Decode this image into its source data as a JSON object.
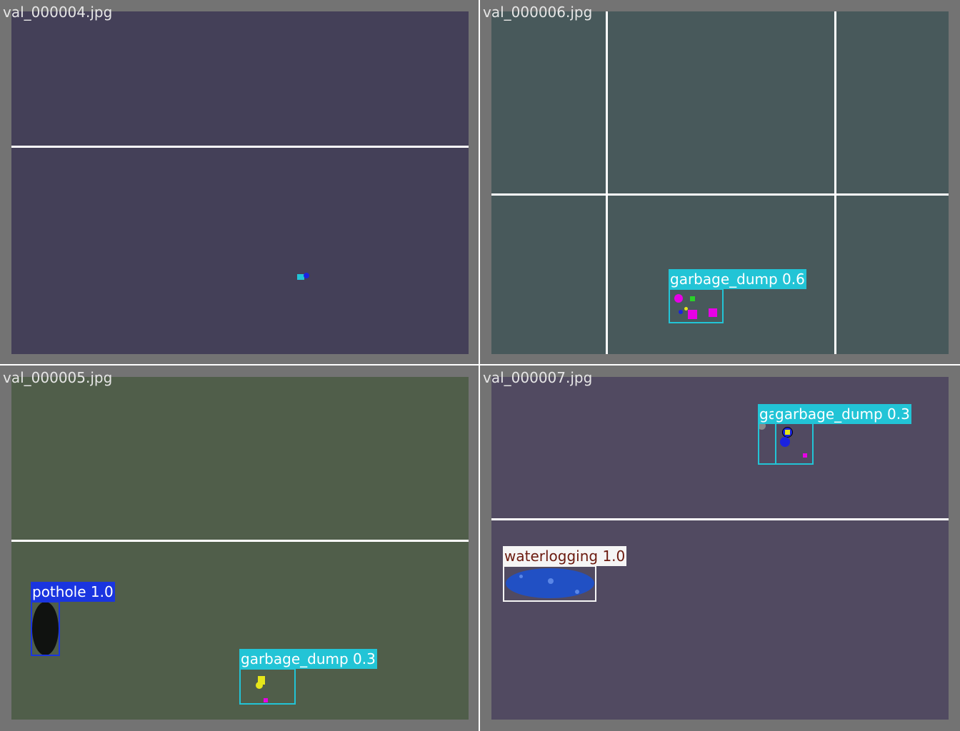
{
  "tiles": [
    {
      "filename": "val_000004.jpg",
      "background": "#444058",
      "detections": []
    },
    {
      "filename": "val_000006.jpg",
      "background": "#48595b",
      "detections": [
        {
          "class": "garbage_dump",
          "score": "0.6",
          "text": "garbage_dump 0.6"
        }
      ]
    },
    {
      "filename": "val_000005.jpg",
      "background": "#505e4a",
      "detections": [
        {
          "class": "pothole",
          "score": "1.0",
          "text": "pothole 1.0"
        },
        {
          "class": "garbage_dump",
          "score": "0.3",
          "text": "garbage_dump 0.3"
        }
      ]
    },
    {
      "filename": "val_000007.jpg",
      "background": "#514a61",
      "detections": [
        {
          "class": "garbage_dump",
          "score": "0.3",
          "text": "garbage_dump 0.3"
        },
        {
          "class": "garbage_dump",
          "score": "0.3",
          "text": "ga"
        },
        {
          "class": "waterlogging",
          "score": "1.0",
          "text": "waterlogging 1.0"
        }
      ]
    }
  ],
  "colors": {
    "garbage_dump": "#22c4d6",
    "pothole": "#1a35e0",
    "waterlogging": "#f5f5f5",
    "waterlogging_text": "#6b1a0f",
    "tile_border": "#737373",
    "road_line": "#ffffff"
  }
}
